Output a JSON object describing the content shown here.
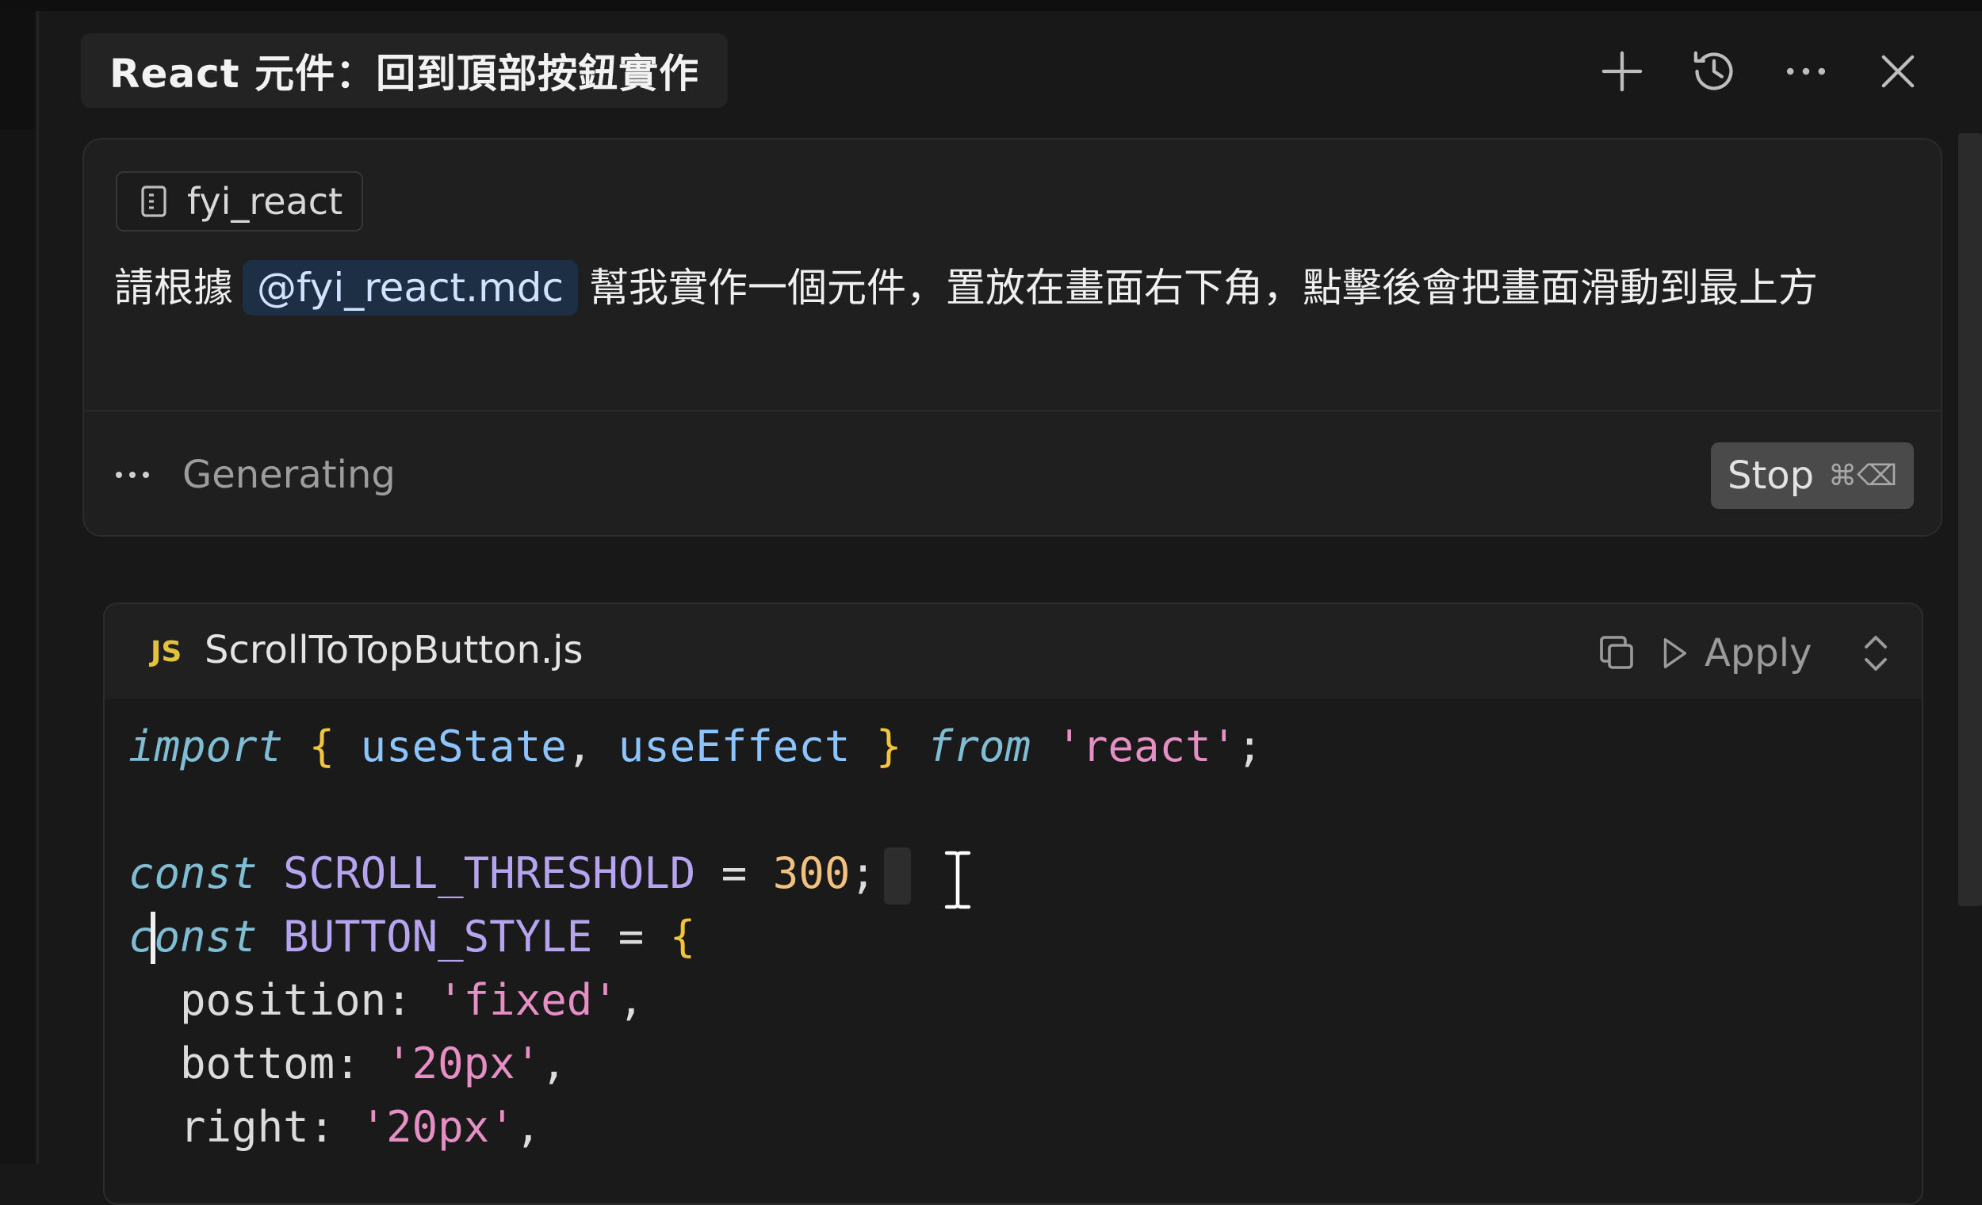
{
  "header": {
    "title": "React 元件：回到頂部按鈕實作",
    "actions": [
      {
        "name": "new-chat",
        "icon": "plus-icon"
      },
      {
        "name": "history",
        "icon": "history-icon"
      },
      {
        "name": "more",
        "icon": "more-icon"
      },
      {
        "name": "close",
        "icon": "close-icon"
      }
    ]
  },
  "composer": {
    "context_chip": {
      "icon": "rules-file-icon",
      "label": "fyi_react"
    },
    "prompt": {
      "before": "請根據",
      "mention": "@fyi_react.mdc",
      "after": "幫我實作一個元件，置放在畫面右下角，點擊後會把畫面滑動到最上方"
    },
    "status": {
      "text": "Generating"
    },
    "stop_button": {
      "label": "Stop",
      "shortcut": "⌘⌫"
    }
  },
  "code_block": {
    "language_badge": "JS",
    "file_name": "ScrollToTopButton.js",
    "apply_label": "Apply",
    "lines": {
      "l1": {
        "kw": "import",
        "open": "{",
        "a": "useState",
        "comma": ",",
        "b": "useEffect",
        "close": "}",
        "from": "from",
        "module": "'react'",
        "semi": ";"
      },
      "l3": {
        "kw": "const",
        "name": "SCROLL_THRESHOLD",
        "eq": "=",
        "value": "300",
        "semi": ";"
      },
      "l4": {
        "kw": "const",
        "name": "BUTTON_STYLE",
        "eq": "=",
        "open": "{"
      },
      "l5": {
        "key": "position:",
        "value": "'fixed'",
        "comma": ","
      },
      "l6": {
        "key": "bottom:",
        "value": "'20px'",
        "comma": ","
      },
      "l7": {
        "key": "right:",
        "value": "'20px'",
        "comma": ","
      }
    }
  },
  "colors": {
    "background": "#181818",
    "mention_bg": "#1d2f45",
    "keyword": "#7fbdd4",
    "brace": "#f2c53d",
    "identifier": "#8cc4ff",
    "constant": "#b7a4f0",
    "string": "#e58fc5",
    "number": "#f1c27f"
  }
}
